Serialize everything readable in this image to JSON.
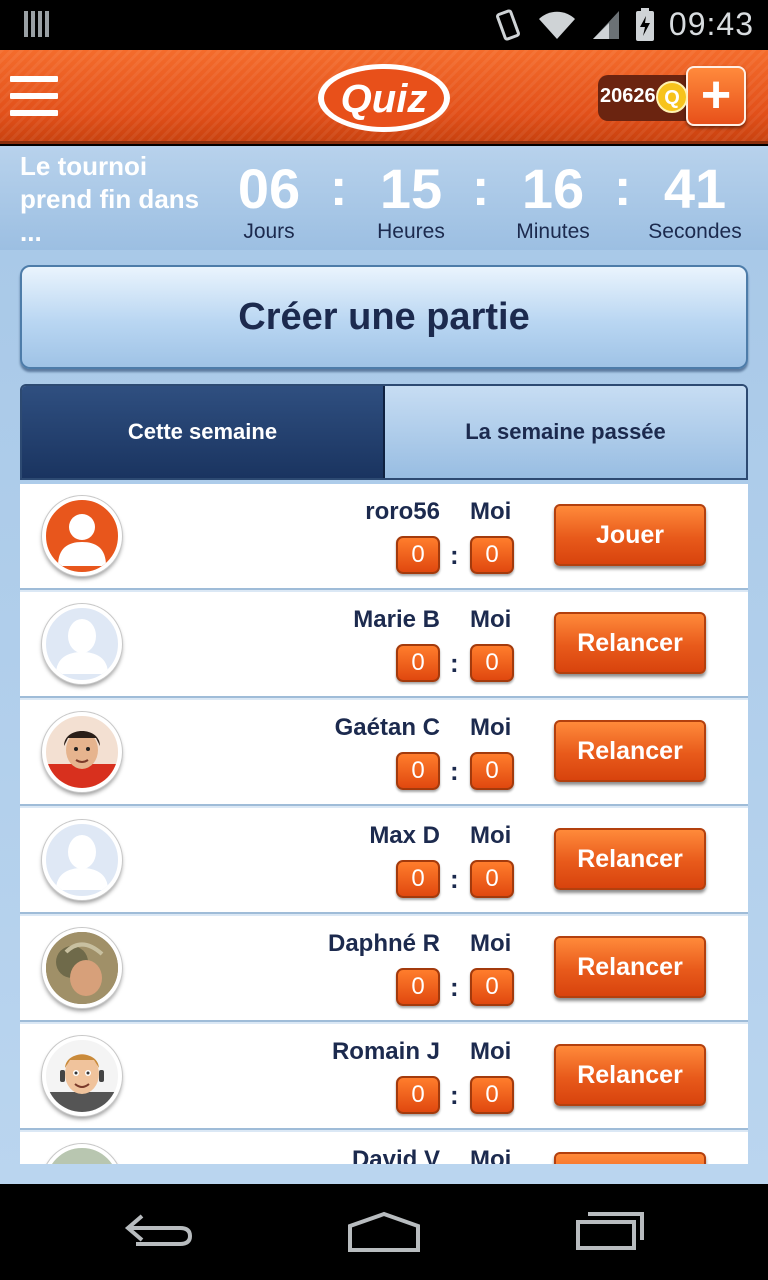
{
  "status_bar": {
    "time": "09:43"
  },
  "app_bar": {
    "logo_text": "Quiz",
    "coins": "20626",
    "coin_symbol": "Q",
    "plus_label": "+"
  },
  "countdown": {
    "label": "Le tournoi prend fin dans ...",
    "days": "06",
    "days_label": "Jours",
    "hours": "15",
    "hours_label": "Heures",
    "minutes": "16",
    "minutes_label": "Minutes",
    "seconds": "41",
    "seconds_label": "Secondes",
    "separator": ":"
  },
  "create_button": "Créer une partie",
  "tabs": [
    {
      "label": "Cette semaine",
      "active": true
    },
    {
      "label": "La semaine passée",
      "active": false
    }
  ],
  "me_label": "Moi",
  "score_separator": ":",
  "games": [
    {
      "name": "roro56",
      "their_score": "0",
      "my_score": "0",
      "action": "Jouer",
      "avatar": "orange-silhouette"
    },
    {
      "name": "Marie B",
      "their_score": "0",
      "my_score": "0",
      "action": "Relancer",
      "avatar": "default-silhouette"
    },
    {
      "name": "Gaétan C",
      "their_score": "0",
      "my_score": "0",
      "action": "Relancer",
      "avatar": "cartoon-man-red"
    },
    {
      "name": "Max D",
      "their_score": "0",
      "my_score": "0",
      "action": "Relancer",
      "avatar": "default-silhouette"
    },
    {
      "name": "Daphné R",
      "their_score": "0",
      "my_score": "0",
      "action": "Relancer",
      "avatar": "photo"
    },
    {
      "name": "Romain J",
      "their_score": "0",
      "my_score": "0",
      "action": "Relancer",
      "avatar": "cartoon-man-headset"
    },
    {
      "name": "David V",
      "their_score": "",
      "my_score": "",
      "action": "",
      "avatar": "photo"
    }
  ],
  "colors": {
    "accent_orange": "#e8561c",
    "navy": "#1c2a4e",
    "sky": "#a9c9e8"
  }
}
